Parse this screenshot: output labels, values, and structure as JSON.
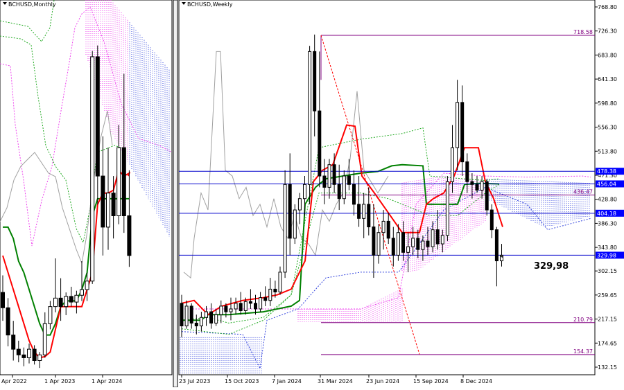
{
  "colors": {
    "background": "#ffffff",
    "frame": "#000000",
    "candle": "#000000",
    "tenkan": "#ff0000",
    "kijun": "#008000",
    "chikou": "#a0a0a0",
    "senkou_dotted_green": "#22aa22",
    "cloud_bear": "#ee44ee",
    "cloud_bull": "#3344dd",
    "level_line": "#0000cc",
    "purple_line": "#800080",
    "trend_line": "#ff0000",
    "price_label_bg": "#0000ff",
    "price_label_fg": "#ffffff"
  },
  "chart_data": [
    {
      "type": "candlestick",
      "title": "BCHUSD,Monthly",
      "x_tick_labels": [
        "Apr 2022",
        "1 Apr 2023",
        "1 Apr 2024"
      ],
      "indicators": [
        "Ichimoku Kinko Hyo"
      ],
      "series": [
        {
          "kind": "ohlc",
          "points": [
            {
              "o": 265,
              "h": 295,
              "l": 215,
              "c": 238
            },
            {
              "o": 238,
              "h": 255,
              "l": 170,
              "c": 190
            },
            {
              "o": 190,
              "h": 215,
              "l": 145,
              "c": 165
            },
            {
              "o": 165,
              "h": 180,
              "l": 142,
              "c": 155
            },
            {
              "o": 155,
              "h": 168,
              "l": 135,
              "c": 150
            },
            {
              "o": 150,
              "h": 175,
              "l": 140,
              "c": 165
            },
            {
              "o": 165,
              "h": 172,
              "l": 138,
              "c": 145
            },
            {
              "o": 145,
              "h": 160,
              "l": 132,
              "c": 155
            },
            {
              "o": 155,
              "h": 230,
              "l": 150,
              "c": 210
            },
            {
              "o": 210,
              "h": 250,
              "l": 200,
              "c": 240
            },
            {
              "o": 240,
              "h": 325,
              "l": 230,
              "c": 255
            },
            {
              "o": 255,
              "h": 290,
              "l": 215,
              "c": 240
            },
            {
              "o": 240,
              "h": 265,
              "l": 225,
              "c": 258
            },
            {
              "o": 258,
              "h": 275,
              "l": 240,
              "c": 248
            },
            {
              "o": 248,
              "h": 268,
              "l": 228,
              "c": 260
            },
            {
              "o": 260,
              "h": 320,
              "l": 250,
              "c": 270
            },
            {
              "o": 270,
              "h": 300,
              "l": 250,
              "c": 285
            },
            {
              "o": 285,
              "h": 690,
              "l": 280,
              "c": 680
            },
            {
              "o": 680,
              "h": 700,
              "l": 420,
              "c": 470
            },
            {
              "o": 470,
              "h": 540,
              "l": 330,
              "c": 380
            },
            {
              "o": 380,
              "h": 520,
              "l": 340,
              "c": 440
            },
            {
              "o": 440,
              "h": 470,
              "l": 360,
              "c": 400
            },
            {
              "o": 400,
              "h": 560,
              "l": 385,
              "c": 520
            },
            {
              "o": 520,
              "h": 650,
              "l": 370,
              "c": 400
            },
            {
              "o": 400,
              "h": 480,
              "l": 310,
              "c": 330
            }
          ]
        },
        {
          "name": "",
          "kind": "tenkan",
          "values": [
            330,
            300,
            270,
            240,
            210,
            180,
            160,
            150,
            152,
            160,
            200,
            240,
            240,
            240,
            240,
            240,
            270,
            300,
            420,
            440,
            440,
            445,
            480,
            470,
            475
          ]
        },
        {
          "name": "",
          "kind": "kijun",
          "values": [
            380,
            380,
            360,
            320,
            300,
            270,
            240,
            210,
            190,
            190,
            210,
            240,
            250,
            250,
            250,
            270,
            300,
            400,
            430,
            430,
            430,
            430,
            430,
            430,
            430
          ]
        }
      ],
      "ylim": [
        120,
        780
      ]
    },
    {
      "type": "candlestick",
      "title": "BCHUSD,Weekly",
      "x_tick_labels": [
        "23 Jul 2023",
        "15 Oct 2023",
        "7 Jan 2024",
        "31 Mar 2024",
        "23 Jun 2024",
        "15 Sep 2024",
        "8 Dec 2024"
      ],
      "y_tick_labels": [
        "768.80",
        "726.30",
        "683.80",
        "641.30",
        "598.80",
        "556.30",
        "513.80",
        "471.30",
        "428.80",
        "386.30",
        "343.80",
        "302.15",
        "259.65",
        "217.15",
        "174.65",
        "132.15"
      ],
      "ylim": [
        115,
        780
      ],
      "indicators": [
        "Ichimoku Kinko Hyo"
      ],
      "series": [
        {
          "kind": "ohlc",
          "points": [
            {
              "o": 245,
              "h": 260,
              "l": 185,
              "c": 205
            },
            {
              "o": 205,
              "h": 250,
              "l": 200,
              "c": 240
            },
            {
              "o": 240,
              "h": 245,
              "l": 200,
              "c": 210
            },
            {
              "o": 210,
              "h": 225,
              "l": 190,
              "c": 205
            },
            {
              "o": 205,
              "h": 230,
              "l": 195,
              "c": 220
            },
            {
              "o": 220,
              "h": 240,
              "l": 205,
              "c": 230
            },
            {
              "o": 230,
              "h": 245,
              "l": 200,
              "c": 210
            },
            {
              "o": 210,
              "h": 235,
              "l": 205,
              "c": 225
            },
            {
              "o": 225,
              "h": 250,
              "l": 210,
              "c": 240
            },
            {
              "o": 240,
              "h": 245,
              "l": 220,
              "c": 230
            },
            {
              "o": 230,
              "h": 255,
              "l": 215,
              "c": 235
            },
            {
              "o": 235,
              "h": 255,
              "l": 225,
              "c": 245
            },
            {
              "o": 245,
              "h": 265,
              "l": 225,
              "c": 232
            },
            {
              "o": 232,
              "h": 255,
              "l": 225,
              "c": 248
            },
            {
              "o": 248,
              "h": 270,
              "l": 235,
              "c": 245
            },
            {
              "o": 245,
              "h": 260,
              "l": 225,
              "c": 235
            },
            {
              "o": 235,
              "h": 265,
              "l": 230,
              "c": 255
            },
            {
              "o": 255,
              "h": 275,
              "l": 240,
              "c": 250
            },
            {
              "o": 250,
              "h": 290,
              "l": 240,
              "c": 270
            },
            {
              "o": 270,
              "h": 285,
              "l": 255,
              "c": 265
            },
            {
              "o": 265,
              "h": 310,
              "l": 260,
              "c": 300
            },
            {
              "o": 300,
              "h": 480,
              "l": 290,
              "c": 455
            },
            {
              "o": 455,
              "h": 510,
              "l": 330,
              "c": 360
            },
            {
              "o": 360,
              "h": 420,
              "l": 350,
              "c": 410
            },
            {
              "o": 410,
              "h": 440,
              "l": 385,
              "c": 430
            },
            {
              "o": 430,
              "h": 470,
              "l": 400,
              "c": 455
            },
            {
              "o": 455,
              "h": 700,
              "l": 420,
              "c": 690
            },
            {
              "o": 690,
              "h": 720,
              "l": 540,
              "c": 585
            },
            {
              "o": 585,
              "h": 690,
              "l": 450,
              "c": 470
            },
            {
              "o": 470,
              "h": 500,
              "l": 420,
              "c": 450
            },
            {
              "o": 450,
              "h": 500,
              "l": 430,
              "c": 490
            },
            {
              "o": 490,
              "h": 510,
              "l": 440,
              "c": 455
            },
            {
              "o": 455,
              "h": 490,
              "l": 410,
              "c": 430
            },
            {
              "o": 430,
              "h": 480,
              "l": 420,
              "c": 470
            },
            {
              "o": 470,
              "h": 500,
              "l": 445,
              "c": 455
            },
            {
              "o": 455,
              "h": 480,
              "l": 400,
              "c": 420
            },
            {
              "o": 420,
              "h": 470,
              "l": 380,
              "c": 395
            },
            {
              "o": 395,
              "h": 440,
              "l": 360,
              "c": 420
            },
            {
              "o": 420,
              "h": 450,
              "l": 365,
              "c": 380
            },
            {
              "o": 380,
              "h": 420,
              "l": 290,
              "c": 330
            },
            {
              "o": 330,
              "h": 385,
              "l": 315,
              "c": 370
            },
            {
              "o": 370,
              "h": 410,
              "l": 340,
              "c": 390
            },
            {
              "o": 390,
              "h": 405,
              "l": 350,
              "c": 360
            },
            {
              "o": 360,
              "h": 380,
              "l": 310,
              "c": 330
            },
            {
              "o": 330,
              "h": 385,
              "l": 320,
              "c": 370
            },
            {
              "o": 370,
              "h": 390,
              "l": 320,
              "c": 335
            },
            {
              "o": 335,
              "h": 370,
              "l": 300,
              "c": 345
            },
            {
              "o": 345,
              "h": 380,
              "l": 330,
              "c": 360
            },
            {
              "o": 360,
              "h": 375,
              "l": 325,
              "c": 340
            },
            {
              "o": 340,
              "h": 365,
              "l": 320,
              "c": 355
            },
            {
              "o": 355,
              "h": 380,
              "l": 330,
              "c": 345
            },
            {
              "o": 345,
              "h": 390,
              "l": 335,
              "c": 375
            },
            {
              "o": 375,
              "h": 410,
              "l": 340,
              "c": 350
            },
            {
              "o": 350,
              "h": 375,
              "l": 335,
              "c": 365
            },
            {
              "o": 365,
              "h": 470,
              "l": 355,
              "c": 460
            },
            {
              "o": 460,
              "h": 560,
              "l": 440,
              "c": 520
            },
            {
              "o": 520,
              "h": 640,
              "l": 480,
              "c": 600
            },
            {
              "o": 600,
              "h": 630,
              "l": 470,
              "c": 495
            },
            {
              "o": 495,
              "h": 510,
              "l": 440,
              "c": 460
            },
            {
              "o": 460,
              "h": 475,
              "l": 430,
              "c": 455
            },
            {
              "o": 455,
              "h": 470,
              "l": 440,
              "c": 445
            },
            {
              "o": 445,
              "h": 470,
              "l": 430,
              "c": 460
            },
            {
              "o": 460,
              "h": 465,
              "l": 400,
              "c": 410
            },
            {
              "o": 410,
              "h": 420,
              "l": 360,
              "c": 375
            },
            {
              "o": 375,
              "h": 380,
              "l": 275,
              "c": 320
            },
            {
              "o": 320,
              "h": 350,
              "l": 310,
              "c": 330
            }
          ]
        }
      ],
      "levels": [
        {
          "value": 718.58,
          "label": "718.58",
          "style": "purple"
        },
        {
          "value": 478.38,
          "label": "478.38",
          "style": "blue"
        },
        {
          "value": 456.04,
          "label": "456.04",
          "style": "blue"
        },
        {
          "value": 436.47,
          "label": "436.47",
          "style": "purple"
        },
        {
          "value": 404.18,
          "label": "404.18",
          "style": "blue"
        },
        {
          "value": 329.98,
          "label": "329.98",
          "style": "blue"
        },
        {
          "value": 210.79,
          "label": "210.79",
          "style": "purple"
        },
        {
          "value": 154.37,
          "label": "154.37",
          "style": "purple"
        }
      ],
      "annotation": "329,98"
    }
  ]
}
